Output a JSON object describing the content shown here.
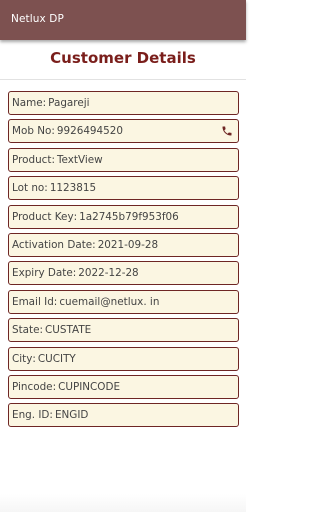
{
  "appbar": {
    "title": "Netlux DP"
  },
  "page": {
    "title": "Customer Details"
  },
  "fields": [
    {
      "label": "Name",
      "value": "Pagareji"
    },
    {
      "label": "Mob No",
      "value": "9926494520"
    },
    {
      "label": "Product",
      "value": "TextView"
    },
    {
      "label": "Lot no",
      "value": "1123815"
    },
    {
      "label": "Product Key",
      "value": "1a2745b79f953f06"
    },
    {
      "label": "Activation Date",
      "value": "2021-09-28"
    },
    {
      "label": "Expiry Date",
      "value": "2022-12-28"
    },
    {
      "label": "Email Id",
      "value": "cuemail@netlux. in"
    },
    {
      "label": "State",
      "value": "CUSTATE"
    },
    {
      "label": "City",
      "value": "CUCITY"
    },
    {
      "label": "Pincode",
      "value": "CUPINCODE"
    },
    {
      "label": "Eng. ID",
      "value": "ENGID"
    }
  ],
  "icons": {
    "phone": "phone-icon"
  },
  "colors": {
    "appbar": "#7d5150",
    "title": "#7a1e1b",
    "field_border": "#6e2624",
    "field_bg": "#fbf6e2"
  }
}
